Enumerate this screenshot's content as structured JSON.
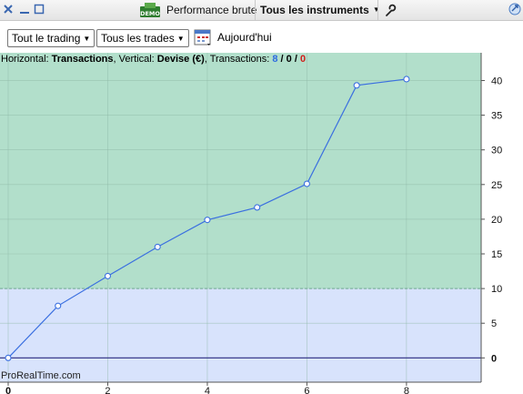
{
  "window": {
    "close_label": "×",
    "demo_label": "DEMO",
    "title": "Performance brute",
    "instrument_select": "Tous les instruments"
  },
  "toolbar": {
    "filter_trading": "Tout le trading",
    "filter_trades": "Tous les trades",
    "date_label": "Aujourd'hui"
  },
  "info": {
    "prefix": "Horizontal: ",
    "horizontal": "Transactions",
    "mid": ", Vertical: ",
    "vertical": "Devise (€)",
    "count_prefix": ", Transactions: ",
    "count_total": "8",
    "sep1": " / ",
    "count_mid": "0",
    "sep2": " / ",
    "count_neg": "0"
  },
  "watermark": "ProRealTime.com",
  "colors": {
    "profit_zone": "#b2dfcb",
    "base_zone": "#d8e3fc",
    "line": "#3a6fe0",
    "zero_line": "#2b2b80"
  },
  "chart_data": {
    "type": "line",
    "x": [
      0,
      1,
      2,
      3,
      4,
      5,
      6,
      7,
      8
    ],
    "y": [
      0,
      7.5,
      11.8,
      16.0,
      19.9,
      21.7,
      25.1,
      39.3,
      40.2
    ],
    "xlim": [
      0,
      9.5
    ],
    "ylim": [
      -3.5,
      44
    ],
    "x_ticks": [
      0,
      2,
      4,
      6,
      8
    ],
    "y_ticks": [
      0,
      5,
      10,
      15,
      20,
      25,
      30,
      35,
      40
    ],
    "threshold": 10,
    "grid": true,
    "y_axis_side": "right"
  }
}
